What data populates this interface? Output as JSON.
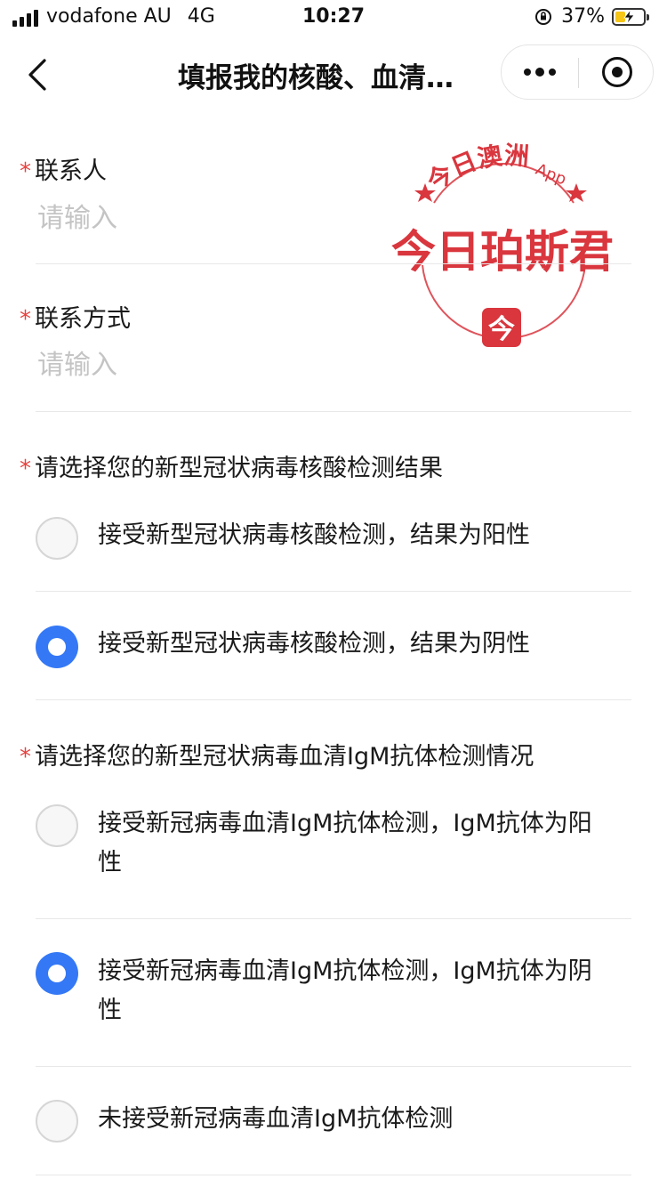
{
  "status_bar": {
    "carrier": "vodafone AU",
    "network": "4G",
    "time": "10:27",
    "battery_percent": "37%",
    "battery_level": 0.37
  },
  "nav": {
    "title": "填报我的核酸、血清…"
  },
  "watermark": {
    "arc_text": "今日澳洲",
    "app_text": "App",
    "main_text": "今日珀斯君",
    "logo_char": "今"
  },
  "form": {
    "contact_person": {
      "label": "联系人",
      "placeholder": "请输入"
    },
    "contact_method": {
      "label": "联系方式",
      "placeholder": "请输入"
    },
    "nucleic_question": {
      "label": "请选择您的新型冠状病毒核酸检测结果",
      "options": [
        {
          "text": "接受新型冠状病毒核酸检测，结果为阳性",
          "selected": false
        },
        {
          "text": "接受新型冠状病毒核酸检测，结果为阴性",
          "selected": true
        }
      ]
    },
    "igm_question": {
      "label": "请选择您的新型冠状病毒血清IgM抗体检测情况",
      "options": [
        {
          "text": "接受新冠病毒血清IgM抗体检测，IgM抗体为阳性",
          "selected": false
        },
        {
          "text": "接受新冠病毒血清IgM抗体检测，IgM抗体为阴性",
          "selected": true
        },
        {
          "text": "未接受新冠病毒血清IgM抗体检测",
          "selected": false
        }
      ]
    }
  },
  "colors": {
    "accent": "#3478f6",
    "required": "#e64340",
    "watermark": "#d9363e",
    "placeholder": "#c4c4c4"
  }
}
